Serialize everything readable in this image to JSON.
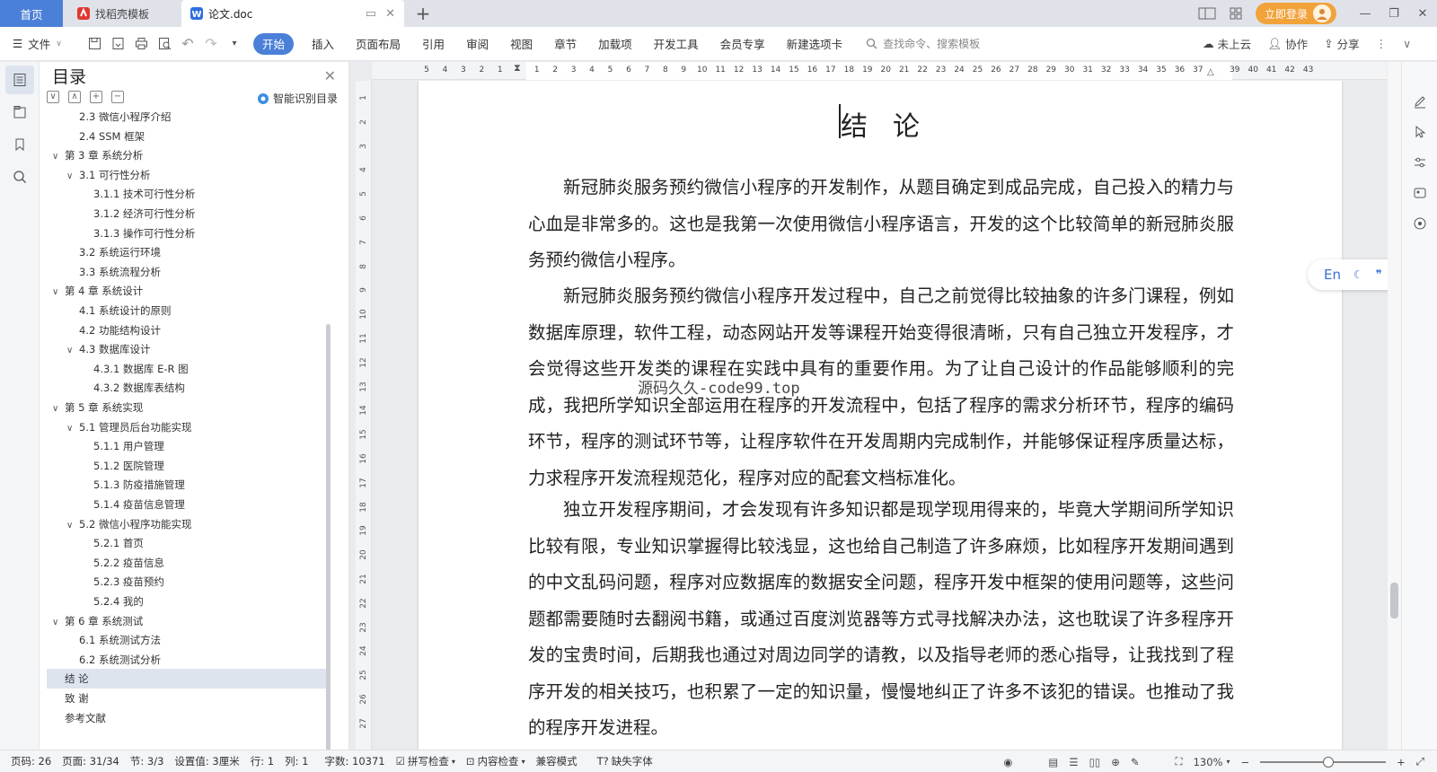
{
  "tabs": {
    "home": "首页",
    "template": "找稻壳模板",
    "document": "论文.doc",
    "add": "+"
  },
  "window": {
    "login": "立即登录"
  },
  "menubar": {
    "file": "文件",
    "items": [
      "开始",
      "插入",
      "页面布局",
      "引用",
      "审阅",
      "视图",
      "章节",
      "加载项",
      "开发工具",
      "会员专享",
      "新建选项卡"
    ],
    "search_placeholder": "查找命令、搜索模板",
    "cloud": "未上云",
    "collab": "协作",
    "share": "分享"
  },
  "toc": {
    "title": "目录",
    "smart": "智能识别目录",
    "items": [
      {
        "label": "2.3 微信小程序介绍",
        "level": 2,
        "arrow": ""
      },
      {
        "label": "2.4 SSM 框架",
        "level": 2,
        "arrow": ""
      },
      {
        "label": "第 3 章  系统分析",
        "level": 1,
        "arrow": "∨"
      },
      {
        "label": "3.1 可行性分析",
        "level": 2,
        "arrow": "∨"
      },
      {
        "label": "3.1.1 技术可行性分析",
        "level": 3,
        "arrow": ""
      },
      {
        "label": "3.1.2 经济可行性分析",
        "level": 3,
        "arrow": ""
      },
      {
        "label": "3.1.3 操作可行性分析",
        "level": 3,
        "arrow": ""
      },
      {
        "label": "3.2 系统运行环境",
        "level": 2,
        "arrow": ""
      },
      {
        "label": "3.3 系统流程分析",
        "level": 2,
        "arrow": ""
      },
      {
        "label": "第 4 章  系统设计",
        "level": 1,
        "arrow": "∨"
      },
      {
        "label": "4.1  系统设计的原则",
        "level": 2,
        "arrow": ""
      },
      {
        "label": "4.2  功能结构设计",
        "level": 2,
        "arrow": ""
      },
      {
        "label": "4.3  数据库设计",
        "level": 2,
        "arrow": "∨"
      },
      {
        "label": "4.3.1  数据库 E-R 图",
        "level": 3,
        "arrow": ""
      },
      {
        "label": "4.3.2  数据库表结构",
        "level": 3,
        "arrow": ""
      },
      {
        "label": "第 5 章  系统实现",
        "level": 1,
        "arrow": "∨"
      },
      {
        "label": "5.1 管理员后台功能实现",
        "level": 2,
        "arrow": "∨"
      },
      {
        "label": "5.1.1  用户管理",
        "level": 3,
        "arrow": ""
      },
      {
        "label": "5.1.2  医院管理",
        "level": 3,
        "arrow": ""
      },
      {
        "label": "5.1.3  防疫措施管理",
        "level": 3,
        "arrow": ""
      },
      {
        "label": "5.1.4  疫苗信息管理",
        "level": 3,
        "arrow": ""
      },
      {
        "label": "5.2  微信小程序功能实现",
        "level": 2,
        "arrow": "∨"
      },
      {
        "label": "5.2.1  首页",
        "level": 3,
        "arrow": ""
      },
      {
        "label": "5.2.2  疫苗信息",
        "level": 3,
        "arrow": ""
      },
      {
        "label": "5.2.3  疫苗预约",
        "level": 3,
        "arrow": ""
      },
      {
        "label": "5.2.4  我的",
        "level": 3,
        "arrow": ""
      },
      {
        "label": "第 6 章  系统测试",
        "level": 1,
        "arrow": "∨"
      },
      {
        "label": "6.1 系统测试方法",
        "level": 2,
        "arrow": ""
      },
      {
        "label": "6.2  系统测试分析",
        "level": 2,
        "arrow": ""
      },
      {
        "label": "结  论",
        "level": 1,
        "arrow": "",
        "selected": true
      },
      {
        "label": "致  谢",
        "level": 1,
        "arrow": ""
      },
      {
        "label": "参考文献",
        "level": 1,
        "arrow": ""
      }
    ]
  },
  "hruler": [
    "5",
    "4",
    "3",
    "2",
    "1",
    "",
    "1",
    "2",
    "3",
    "4",
    "5",
    "6",
    "7",
    "8",
    "9",
    "10",
    "11",
    "12",
    "13",
    "14",
    "15",
    "16",
    "17",
    "18",
    "19",
    "20",
    "21",
    "22",
    "23",
    "24",
    "25",
    "26",
    "27",
    "28",
    "29",
    "30",
    "31",
    "32",
    "33",
    "34",
    "35",
    "36",
    "37",
    "",
    "39",
    "40",
    "41",
    "42",
    "43"
  ],
  "vruler": [
    "1",
    "2",
    "3",
    "4",
    "5",
    "6",
    "7",
    "8",
    "9",
    "10",
    "11",
    "12",
    "13",
    "14",
    "15",
    "16",
    "17",
    "18",
    "19",
    "20",
    "21",
    "22",
    "23",
    "24",
    "25",
    "26",
    "27"
  ],
  "document": {
    "title": "结论",
    "paragraphs": [
      "新冠肺炎服务预约微信小程序的开发制作，从题目确定到成品完成，自己投入的精力与心血是非常多的。这也是我第一次使用微信小程序语言，开发的这个比较简单的新冠肺炎服务预约微信小程序。",
      "新冠肺炎服务预约微信小程序开发过程中，自己之前觉得比较抽象的许多门课程，例如数据库原理，软件工程，动态网站开发等课程开始变得很清晰，只有自己独立开发程序，才会觉得这些开发类的课程在实践中具有的重要作用。为了让自己设计的作品能够顺利的完成，我把所学知识全部运用在程序的开发流程中，包括了程序的需求分析环节，程序的编码环节，程序的测试环节等，让程序软件在开发周期内完成制作，并能够保证程序质量达标，力求程序开发流程规范化，程序对应的配套文档标准化。",
      "独立开发程序期间，才会发现有许多知识都是现学现用得来的，毕竟大学期间所学知识比较有限，专业知识掌握得比较浅显，这也给自己制造了许多麻烦，比如程序开发期间遇到的中文乱码问题，程序对应数据库的数据安全问题，程序开发中框架的使用问题等，这些问题都需要随时去翻阅书籍，或通过百度浏览器等方式寻找解决办法，这也耽误了许多程序开发的宝贵时间，后期我也通过对周边同学的请教，以及指导老师的悉心指导，让我找到了程序开发的相关技巧，也积累了一定的知识量，慢慢地纠正了许多不该犯的错误。也推动了我的程序开发进程。"
    ],
    "watermark": "源码久久-code99.top"
  },
  "translate": {
    "label": "En"
  },
  "status": {
    "page_code": "页码: 26",
    "pages": "页面: 31/34",
    "section": "节: 3/3",
    "setting": "设置值: 3厘米",
    "row": "行: 1",
    "col": "列: 1",
    "words": "字数: 10371",
    "spell": "拼写检查",
    "content": "内容检查",
    "compat": "兼容模式",
    "missing_font": "缺失字体",
    "zoom": "130%"
  }
}
